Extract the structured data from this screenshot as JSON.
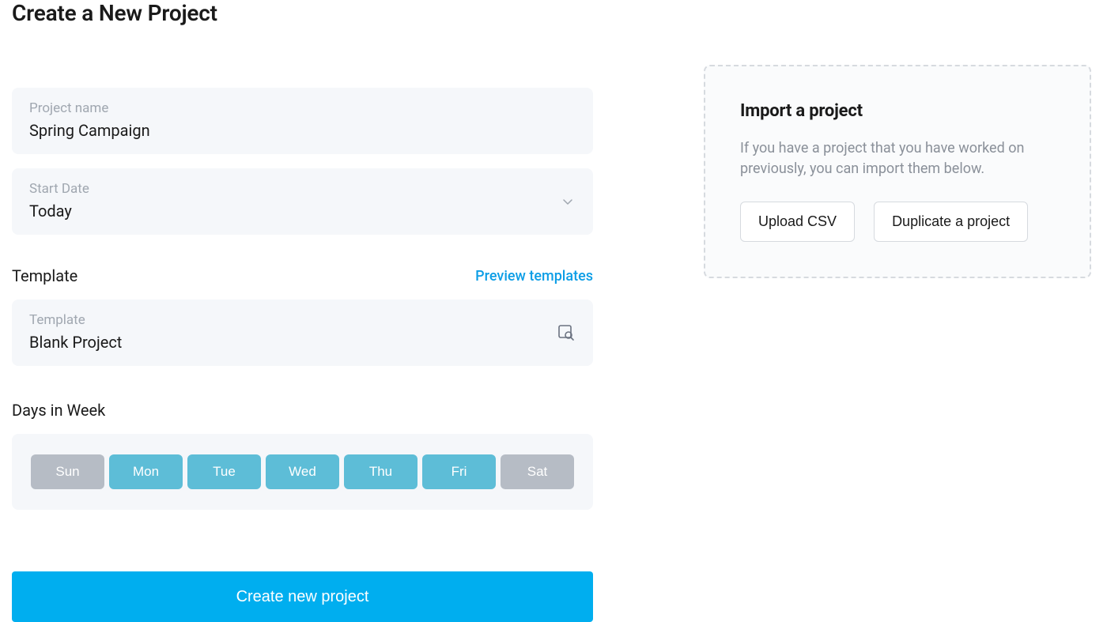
{
  "page": {
    "title": "Create a New Project"
  },
  "form": {
    "projectName": {
      "label": "Project name",
      "value": "Spring Campaign"
    },
    "startDate": {
      "label": "Start Date",
      "value": "Today"
    },
    "templateSection": {
      "title": "Template",
      "previewLink": "Preview templates"
    },
    "template": {
      "label": "Template",
      "value": "Blank Project"
    },
    "daysSection": {
      "title": "Days in Week"
    },
    "days": [
      {
        "label": "Sun",
        "active": false
      },
      {
        "label": "Mon",
        "active": true
      },
      {
        "label": "Tue",
        "active": true
      },
      {
        "label": "Wed",
        "active": true
      },
      {
        "label": "Thu",
        "active": true
      },
      {
        "label": "Fri",
        "active": true
      },
      {
        "label": "Sat",
        "active": false
      }
    ],
    "submitLabel": "Create new project"
  },
  "import": {
    "title": "Import a project",
    "description": "If you have a project that you have worked on previously, you can import them below.",
    "uploadLabel": "Upload CSV",
    "duplicateLabel": "Duplicate a project"
  },
  "colors": {
    "primary": "#00aeef",
    "dayActive": "#5dbdd7",
    "dayInactive": "#b6bcc5",
    "fieldBg": "#f5f7fa",
    "muted": "#a0a7b0"
  }
}
